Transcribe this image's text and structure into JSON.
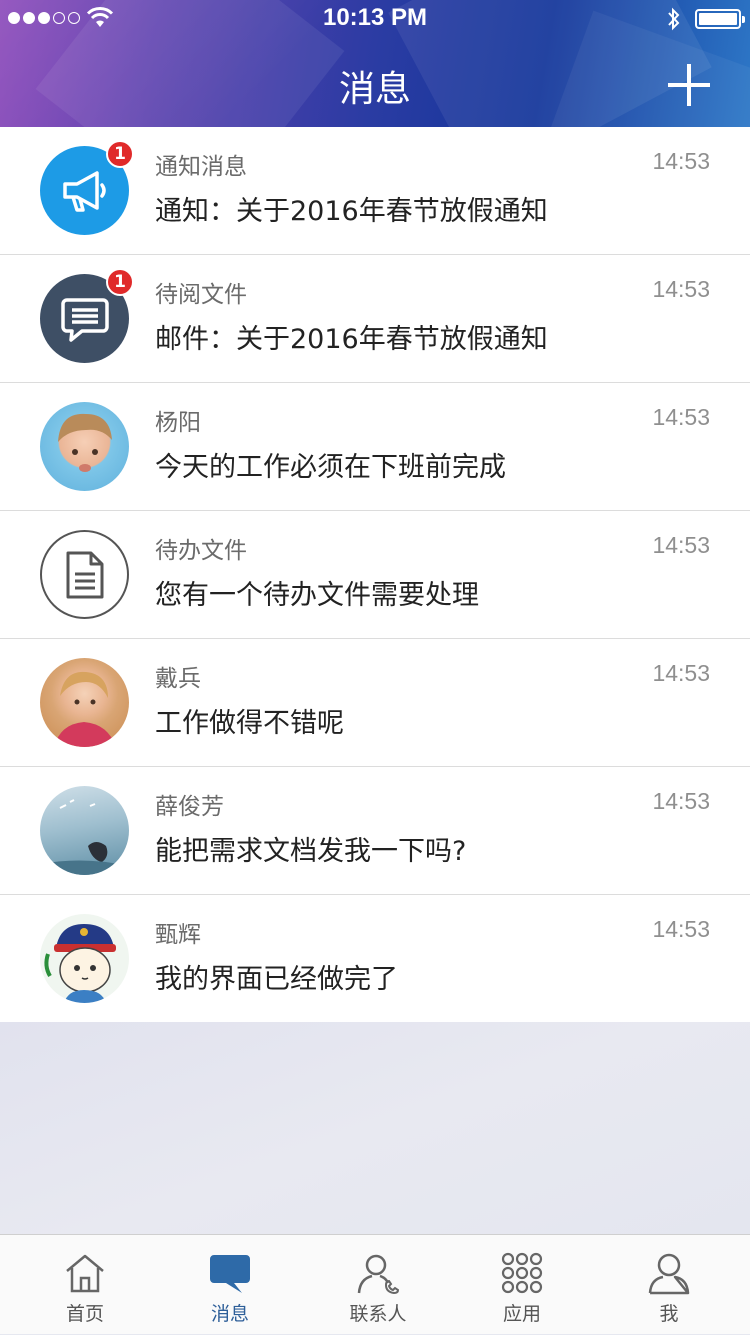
{
  "status_bar": {
    "time": "10:13 PM",
    "signal_strength_dots": 3,
    "battery_level": 1.0
  },
  "header": {
    "title": "消息",
    "add_icon": "plus-icon"
  },
  "messages": [
    {
      "sender": "通知消息",
      "time": "14:53",
      "preview": "通知：关于2016年春节放假通知",
      "badge": "1",
      "avatar": "megaphone-icon",
      "avatar_color": "#1d9be6"
    },
    {
      "sender": "待阅文件",
      "time": "14:53",
      "preview": "邮件：关于2016年春节放假通知",
      "badge": "1",
      "avatar": "chat-bubble-icon",
      "avatar_color": "#3e4f65"
    },
    {
      "sender": "杨阳",
      "time": "14:53",
      "preview": "今天的工作必须在下班前完成",
      "avatar": "boy-photo"
    },
    {
      "sender": "待办文件",
      "time": "14:53",
      "preview": "您有一个待办文件需要处理",
      "avatar": "document-icon"
    },
    {
      "sender": "戴兵",
      "time": "14:53",
      "preview": "工作做得不错呢",
      "avatar": "girl-photo"
    },
    {
      "sender": "薛俊芳",
      "time": "14:53",
      "preview": "能把需求文档发我一下吗?",
      "avatar": "landscape-photo"
    },
    {
      "sender": "甄辉",
      "time": "14:53",
      "preview": "我的界面已经做完了",
      "avatar": "cartoon-avatar"
    }
  ],
  "tabbar": {
    "tabs": [
      {
        "label": "首页",
        "icon": "home-icon"
      },
      {
        "label": "消息",
        "icon": "message-icon",
        "active": true
      },
      {
        "label": "联系人",
        "icon": "contact-icon"
      },
      {
        "label": "应用",
        "icon": "apps-grid-icon"
      },
      {
        "label": "我",
        "icon": "person-icon"
      }
    ]
  },
  "colors": {
    "accent": "#2e5f99",
    "badge": "#e02a2a",
    "notification_avatar": "#1d9be6",
    "pending_read_avatar": "#3e4f65"
  }
}
